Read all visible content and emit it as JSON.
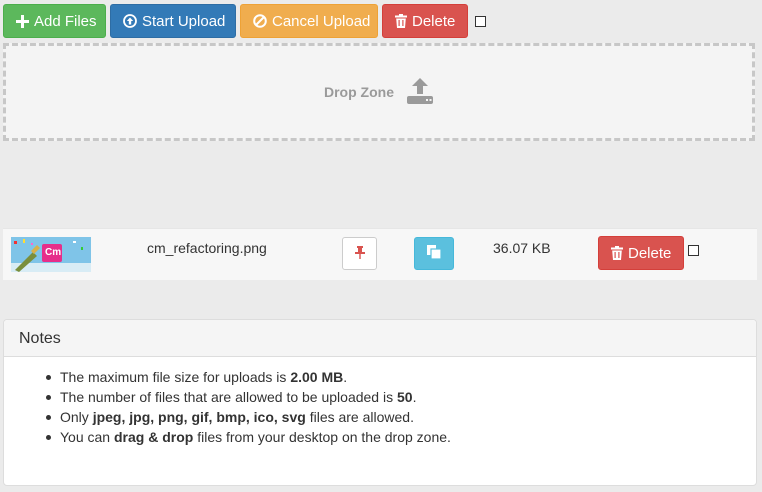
{
  "toolbar": {
    "add_files": "Add Files",
    "start_upload": "Start Upload",
    "cancel_upload": "Cancel Upload",
    "delete": "Delete"
  },
  "dropzone": {
    "label": "Drop Zone"
  },
  "files": [
    {
      "name": "cm_refactoring.png",
      "size": "36.07 KB",
      "delete": "Delete",
      "thumb_text": "Cm"
    }
  ],
  "notes": {
    "title": "Notes",
    "items": [
      [
        {
          "t": "The maximum file size for uploads is ",
          "b": false
        },
        {
          "t": "2.00 MB",
          "b": true
        },
        {
          "t": ".",
          "b": false
        }
      ],
      [
        {
          "t": "The number of files that are allowed to be uploaded is ",
          "b": false
        },
        {
          "t": "50",
          "b": true
        },
        {
          "t": ".",
          "b": false
        }
      ],
      [
        {
          "t": "Only ",
          "b": false
        },
        {
          "t": "jpeg, jpg, png, gif, bmp, ico, svg",
          "b": true
        },
        {
          "t": " files are allowed.",
          "b": false
        }
      ],
      [
        {
          "t": "You can ",
          "b": false
        },
        {
          "t": "drag & drop",
          "b": true
        },
        {
          "t": " files from your desktop on the drop zone.",
          "b": false
        }
      ]
    ]
  },
  "colors": {
    "success": "#5cb85c",
    "primary": "#337ab7",
    "warning": "#f0ad4e",
    "danger": "#d9534f",
    "info": "#5bc0de"
  }
}
